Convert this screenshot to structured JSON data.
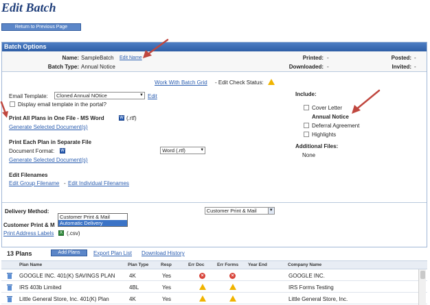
{
  "page": {
    "title": "Edit Batch",
    "return_label": "Return to Previous Page"
  },
  "panel": {
    "header": "Batch Options"
  },
  "summary": {
    "name_label": "Name:",
    "name_value": "SampleBatch",
    "edit_name": "Edit Name",
    "type_label": "Batch Type:",
    "type_value": "Annual Notice",
    "printed_label": "Printed:",
    "printed_value": "-",
    "downloaded_label": "Downloaded:",
    "downloaded_value": "-",
    "posted_label": "Posted:",
    "posted_value": "-",
    "invited_label": "Invited:",
    "invited_value": "-"
  },
  "check": {
    "grid_link": "Work With Batch Grid",
    "status_text": "- Edit Check Status:"
  },
  "email": {
    "label": "Email Template:",
    "selected": "Cloned Annual NOtice",
    "edit": "Edit",
    "portal_label": "Display email template in the portal?"
  },
  "print_one": {
    "title": "Print All Plans in One File - MS Word",
    "ext": "(.rtf)",
    "generate": "Generate Selected Document(s)"
  },
  "print_each": {
    "title": "Print Each Plan in Separate File",
    "format_label": "Document Format:",
    "format_selected": "Word (.rtf)",
    "generate": "Generate Selected Document(s)"
  },
  "filenames": {
    "title": "Edit Filenames",
    "group": "Edit Group Filename",
    "sep": "-",
    "individual": "Edit Individual Filenames"
  },
  "include": {
    "title": "Include:",
    "items": [
      {
        "label": "Cover Letter",
        "checked": false
      },
      {
        "label": "Annual Notice",
        "checked": true
      },
      {
        "label": "Deferral Agreement",
        "checked": false
      },
      {
        "label": "Highlights",
        "checked": false
      }
    ],
    "additional_title": "Additional Files:",
    "additional_value": "None"
  },
  "delivery": {
    "label": "Delivery Method:",
    "selected": "Customer Print & Mail",
    "options": [
      "Customer Print & Mail",
      "Automatic Delivery"
    ],
    "cpm_label": "Customer Print & M",
    "address_link": "Print Address Labels",
    "address_ext": "(.csv)"
  },
  "plans": {
    "count_label": "13 Plans",
    "add": "Add Plans",
    "export": "Export Plan List",
    "history": "Download History",
    "columns": [
      "Plan Name",
      "Plan Type",
      "Resp",
      "Err Doc",
      "Err Forms",
      "Year End",
      "Company Name"
    ],
    "rows": [
      {
        "name": "GOOGLE INC. 401(K) SAVINGS PLAN",
        "type": "4K",
        "resp": "Yes",
        "err_doc": "error",
        "err_forms": "error",
        "company": "GOOGLE INC."
      },
      {
        "name": "IRS 403b Limited",
        "type": "4BL",
        "resp": "Yes",
        "err_doc": "warning",
        "err_forms": "warning",
        "company": "IRS Forms Testing"
      },
      {
        "name": "Little General Store, Inc. 401(K) Plan",
        "type": "4K",
        "resp": "Yes",
        "err_doc": "warning",
        "err_forms": "warning",
        "company": "Little General Store, Inc."
      }
    ]
  },
  "colors": {
    "accent": "#2e5ea6",
    "link": "#2a5db0",
    "arrow": "#c0473f",
    "title": "#1f3e7a"
  }
}
